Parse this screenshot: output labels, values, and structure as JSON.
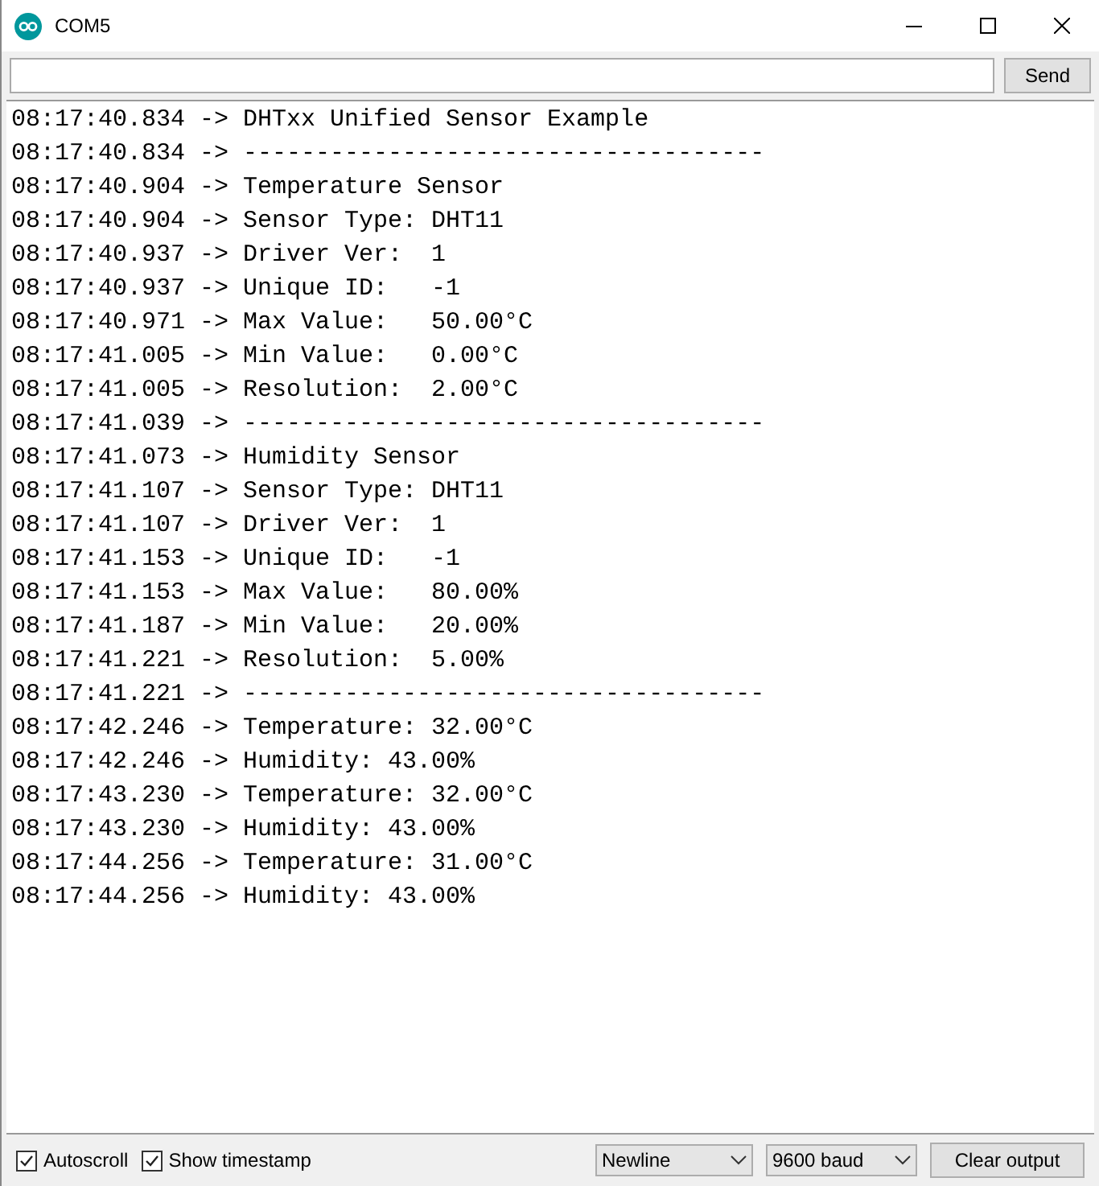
{
  "window": {
    "title": "COM5"
  },
  "input": {
    "button": "Send"
  },
  "lines": [
    "08:17:40.834 -> DHTxx Unified Sensor Example",
    "08:17:40.834 -> ------------------------------------",
    "08:17:40.904 -> Temperature Sensor",
    "08:17:40.904 -> Sensor Type: DHT11",
    "08:17:40.937 -> Driver Ver:  1",
    "08:17:40.937 -> Unique ID:   -1",
    "08:17:40.971 -> Max Value:   50.00°C",
    "08:17:41.005 -> Min Value:   0.00°C",
    "08:17:41.005 -> Resolution:  2.00°C",
    "08:17:41.039 -> ------------------------------------",
    "08:17:41.073 -> Humidity Sensor",
    "08:17:41.107 -> Sensor Type: DHT11",
    "08:17:41.107 -> Driver Ver:  1",
    "08:17:41.153 -> Unique ID:   -1",
    "08:17:41.153 -> Max Value:   80.00%",
    "08:17:41.187 -> Min Value:   20.00%",
    "08:17:41.221 -> Resolution:  5.00%",
    "08:17:41.221 -> ------------------------------------",
    "08:17:42.246 -> Temperature: 32.00°C",
    "08:17:42.246 -> Humidity: 43.00%",
    "08:17:43.230 -> Temperature: 32.00°C",
    "08:17:43.230 -> Humidity: 43.00%",
    "08:17:44.256 -> Temperature: 31.00°C",
    "08:17:44.256 -> Humidity: 43.00%"
  ],
  "footer": {
    "checkboxes": [
      {
        "label": "Autoscroll",
        "checked": true
      },
      {
        "label": "Show timestamp",
        "checked": true
      }
    ],
    "selects": [
      "Newline",
      "9600 baud"
    ],
    "button": "Clear output"
  }
}
